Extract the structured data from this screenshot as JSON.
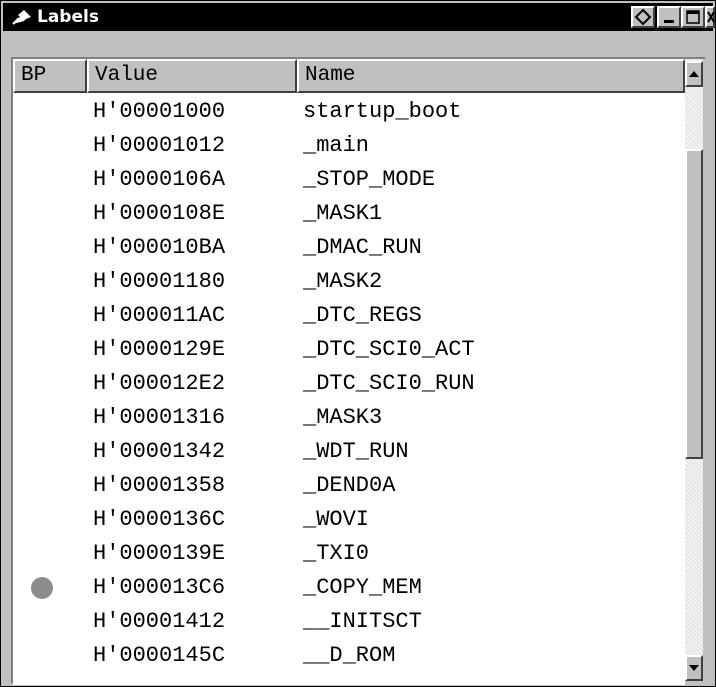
{
  "window": {
    "title": "Labels",
    "title_icon": "pin-icon",
    "buttons": [
      "diamond-icon",
      "minimize-icon",
      "maximize-icon",
      "close-icon"
    ]
  },
  "columns": {
    "bp": "BP",
    "value": "Value",
    "name": "Name"
  },
  "rows": [
    {
      "value": "H'00001000",
      "name": "startup_boot",
      "bp": false
    },
    {
      "value": "H'00001012",
      "name": "_main",
      "bp": false
    },
    {
      "value": "H'0000106A",
      "name": "_STOP_MODE",
      "bp": false
    },
    {
      "value": "H'0000108E",
      "name": "_MASK1",
      "bp": false
    },
    {
      "value": "H'000010BA",
      "name": "_DMAC_RUN",
      "bp": false
    },
    {
      "value": "H'00001180",
      "name": "_MASK2",
      "bp": false
    },
    {
      "value": "H'000011AC",
      "name": "_DTC_REGS",
      "bp": false
    },
    {
      "value": "H'0000129E",
      "name": "_DTC_SCI0_ACT",
      "bp": false
    },
    {
      "value": "H'000012E2",
      "name": "_DTC_SCI0_RUN",
      "bp": false
    },
    {
      "value": "H'00001316",
      "name": "_MASK3",
      "bp": false
    },
    {
      "value": "H'00001342",
      "name": "_WDT_RUN",
      "bp": false
    },
    {
      "value": "H'00001358",
      "name": "_DEND0A",
      "bp": false
    },
    {
      "value": "H'0000136C",
      "name": "_WOVI",
      "bp": false
    },
    {
      "value": "H'0000139E",
      "name": "_TXI0",
      "bp": false
    },
    {
      "value": "H'000013C6",
      "name": "_COPY_MEM",
      "bp": true
    },
    {
      "value": "H'00001412",
      "name": "__INITSCT",
      "bp": false
    },
    {
      "value": "H'0000145C",
      "name": "__D_ROM",
      "bp": false
    }
  ],
  "colors": {
    "titlebar": "#000000",
    "breakpoint": "#8c8c8c"
  }
}
